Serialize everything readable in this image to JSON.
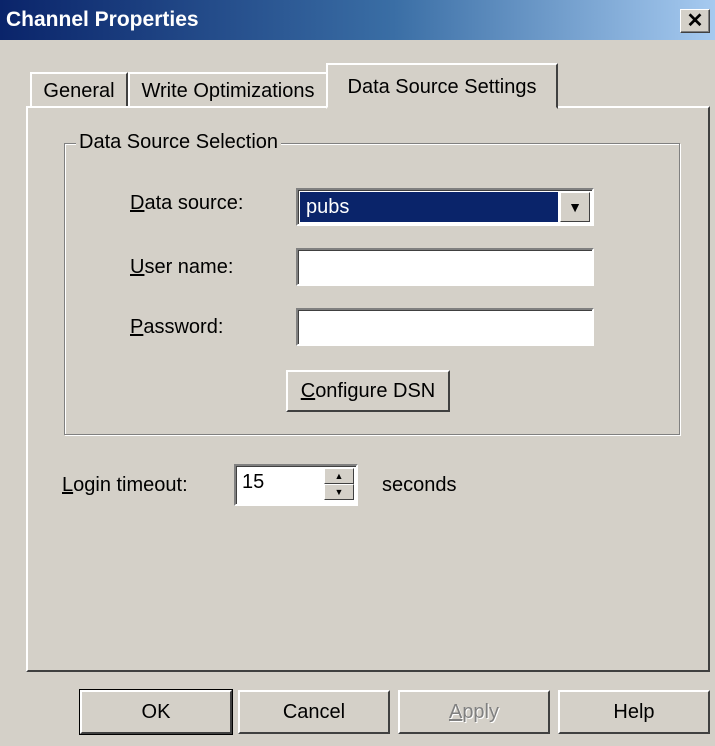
{
  "window": {
    "title": "Channel Properties",
    "close_glyph": "✕"
  },
  "tabs": [
    {
      "label": "General",
      "active": false
    },
    {
      "label": "Write Optimizations",
      "active": false
    },
    {
      "label": "Data Source Settings",
      "active": true
    }
  ],
  "group": {
    "label": "Data Source Selection",
    "data_source": {
      "accel": "D",
      "label_rest": "ata source:",
      "value": "pubs"
    },
    "user_name": {
      "accel": "U",
      "label_rest": "ser name:",
      "value": ""
    },
    "password": {
      "accel": "P",
      "label_rest": "assword:",
      "value": ""
    },
    "configure_button": {
      "accel": "C",
      "label_rest": "onfigure DSN"
    }
  },
  "login_timeout": {
    "accel": "L",
    "label_rest": "ogin timeout:",
    "value": "15",
    "unit": "seconds"
  },
  "footer": {
    "ok": "OK",
    "cancel": "Cancel",
    "apply_accel": "A",
    "apply_rest": "pply",
    "help": "Help"
  },
  "icons": {
    "dropdown": "▼",
    "spin_up": "▲",
    "spin_down": "▼"
  }
}
